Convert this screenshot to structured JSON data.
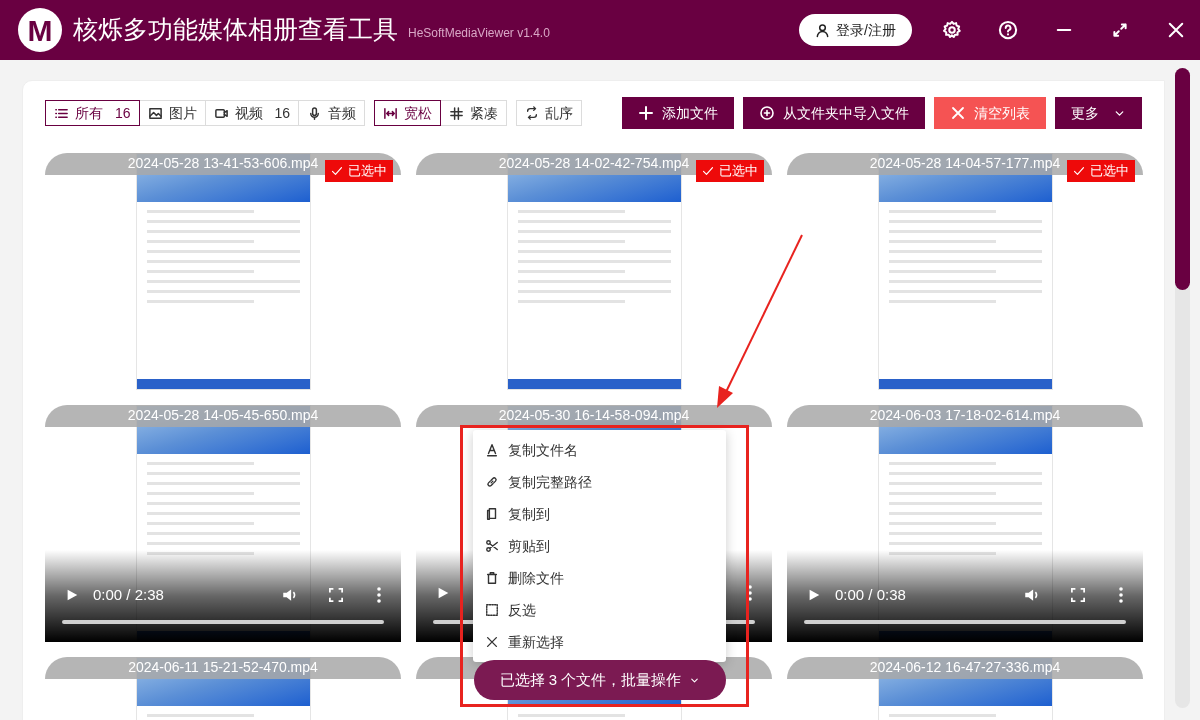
{
  "window": {
    "logo": "M",
    "title": "核烁多功能媒体相册查看工具",
    "subtitle": "HeSoftMediaViewer v1.4.0",
    "login_button": "登录/注册"
  },
  "filters": [
    {
      "kind": "all",
      "label": "所有",
      "count": "16",
      "selected": true
    },
    {
      "kind": "image",
      "label": "图片",
      "selected": false
    },
    {
      "kind": "video",
      "label": "视频",
      "count": "16",
      "selected": false
    },
    {
      "kind": "audio",
      "label": "音频",
      "selected": false
    }
  ],
  "layout_modes": [
    {
      "kind": "loose",
      "label": "宽松",
      "selected": true
    },
    {
      "kind": "compact",
      "label": "紧凑",
      "selected": false
    }
  ],
  "shuffle_button": "乱序",
  "actions": [
    {
      "kind": "add",
      "label": "添加文件"
    },
    {
      "kind": "import",
      "label": "从文件夹中导入文件"
    },
    {
      "kind": "clear",
      "label": "清空列表"
    },
    {
      "kind": "more",
      "label": "更多"
    }
  ],
  "files": [
    {
      "name": "2024-05-28 13-41-53-606.mp4",
      "kind": "thumbnail",
      "selected": true,
      "badge": "已选中"
    },
    {
      "name": "2024-05-28 14-02-42-754.mp4",
      "kind": "thumbnail",
      "selected": true,
      "badge": "已选中"
    },
    {
      "name": "2024-05-28 14-04-57-177.mp4",
      "kind": "thumbnail",
      "selected": true,
      "badge": "已选中"
    },
    {
      "name": "2024-05-28 14-05-45-650.mp4",
      "kind": "player",
      "selected": false,
      "time": "0:00 / 2:38"
    },
    {
      "name": "2024-05-30 16-14-58-094.mp4",
      "kind": "player",
      "selected": false
    },
    {
      "name": "2024-06-03 17-18-02-614.mp4",
      "kind": "player",
      "selected": false,
      "time": "0:00 / 0:38"
    },
    {
      "name": "2024-06-11 15-21-52-470.mp4",
      "kind": "thumbnail",
      "selected": false
    },
    {
      "kind": "thumbnail",
      "selected": false
    },
    {
      "name": "2024-06-12 16-47-27-336.mp4",
      "kind": "thumbnail",
      "selected": false
    }
  ],
  "context_menu": [
    {
      "kind": "text",
      "label": "复制文件名"
    },
    {
      "kind": "link",
      "label": "复制完整路径"
    },
    {
      "kind": "copy",
      "label": "复制到"
    },
    {
      "kind": "cut",
      "label": "剪贴到"
    },
    {
      "kind": "delete",
      "label": "删除文件"
    },
    {
      "kind": "invert",
      "label": "反选"
    },
    {
      "kind": "reset",
      "label": "重新选择"
    }
  ],
  "batch_button": "已选择 3 个文件，批量操作"
}
